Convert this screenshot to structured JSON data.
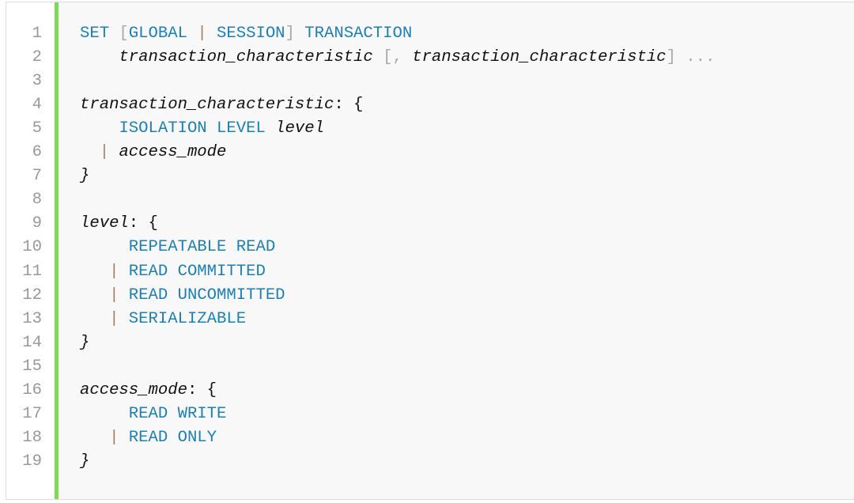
{
  "code": {
    "accent_bar_color": "#7ed957",
    "colors": {
      "keyword": "#1b80b6",
      "punctuation": "#a8a8a8",
      "operator": "#a8805e",
      "text": "#111111",
      "line_number": "#999999"
    },
    "lines": [
      {
        "n": "1",
        "tokens": [
          {
            "t": "kw",
            "v": "SET "
          },
          {
            "t": "pu",
            "v": "["
          },
          {
            "t": "kw",
            "v": "GLOBAL "
          },
          {
            "t": "op",
            "v": "|"
          },
          {
            "t": "kw",
            "v": " SESSION"
          },
          {
            "t": "pu",
            "v": "]"
          },
          {
            "t": "kw",
            "v": " TRANSACTION"
          }
        ]
      },
      {
        "n": "2",
        "tokens": [
          {
            "t": "pl",
            "v": "    "
          },
          {
            "t": "it",
            "v": "transaction_characteristic"
          },
          {
            "t": "pu",
            "v": " [, "
          },
          {
            "t": "it",
            "v": "transaction_characteristic"
          },
          {
            "t": "pu",
            "v": "] ..."
          }
        ]
      },
      {
        "n": "3",
        "tokens": []
      },
      {
        "n": "4",
        "tokens": [
          {
            "t": "it",
            "v": "transaction_characteristic"
          },
          {
            "t": "pl",
            "v": ": {"
          }
        ]
      },
      {
        "n": "5",
        "tokens": [
          {
            "t": "pl",
            "v": "    "
          },
          {
            "t": "kw",
            "v": "ISOLATION LEVEL "
          },
          {
            "t": "it",
            "v": "level"
          }
        ]
      },
      {
        "n": "6",
        "tokens": [
          {
            "t": "pl",
            "v": "  "
          },
          {
            "t": "op",
            "v": "|"
          },
          {
            "t": "pl",
            "v": " "
          },
          {
            "t": "it",
            "v": "access_mode"
          }
        ]
      },
      {
        "n": "7",
        "tokens": [
          {
            "t": "it",
            "v": "}"
          }
        ]
      },
      {
        "n": "8",
        "tokens": []
      },
      {
        "n": "9",
        "tokens": [
          {
            "t": "it",
            "v": "level"
          },
          {
            "t": "pl",
            "v": ": {"
          }
        ]
      },
      {
        "n": "10",
        "tokens": [
          {
            "t": "pl",
            "v": "     "
          },
          {
            "t": "kw",
            "v": "REPEATABLE READ"
          }
        ]
      },
      {
        "n": "11",
        "tokens": [
          {
            "t": "pl",
            "v": "   "
          },
          {
            "t": "op",
            "v": "|"
          },
          {
            "t": "pl",
            "v": " "
          },
          {
            "t": "kw",
            "v": "READ COMMITTED"
          }
        ]
      },
      {
        "n": "12",
        "tokens": [
          {
            "t": "pl",
            "v": "   "
          },
          {
            "t": "op",
            "v": "|"
          },
          {
            "t": "pl",
            "v": " "
          },
          {
            "t": "kw",
            "v": "READ UNCOMMITTED"
          }
        ]
      },
      {
        "n": "13",
        "tokens": [
          {
            "t": "pl",
            "v": "   "
          },
          {
            "t": "op",
            "v": "|"
          },
          {
            "t": "pl",
            "v": " "
          },
          {
            "t": "kw",
            "v": "SERIALIZABLE"
          }
        ]
      },
      {
        "n": "14",
        "tokens": [
          {
            "t": "it",
            "v": "}"
          }
        ]
      },
      {
        "n": "15",
        "tokens": []
      },
      {
        "n": "16",
        "tokens": [
          {
            "t": "it",
            "v": "access_mode"
          },
          {
            "t": "pl",
            "v": ": {"
          }
        ]
      },
      {
        "n": "17",
        "tokens": [
          {
            "t": "pl",
            "v": "     "
          },
          {
            "t": "kw",
            "v": "READ WRITE"
          }
        ]
      },
      {
        "n": "18",
        "tokens": [
          {
            "t": "pl",
            "v": "   "
          },
          {
            "t": "op",
            "v": "|"
          },
          {
            "t": "pl",
            "v": " "
          },
          {
            "t": "kw",
            "v": "READ ONLY"
          }
        ]
      },
      {
        "n": "19",
        "tokens": [
          {
            "t": "it",
            "v": "}"
          }
        ]
      }
    ]
  }
}
